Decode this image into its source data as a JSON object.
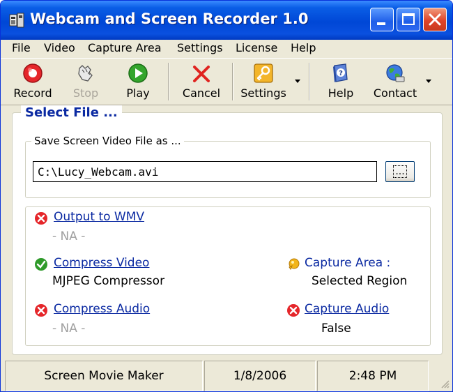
{
  "window": {
    "title": "Webcam and Screen Recorder 1.0",
    "icon": "app-recorder-icon"
  },
  "menu": [
    "File",
    "Video",
    "Capture Area",
    "Settings",
    "License",
    "Help"
  ],
  "toolbar": {
    "record": "Record",
    "stop": "Stop",
    "play": "Play",
    "cancel": "Cancel",
    "settings": "Settings",
    "help": "Help",
    "contact": "Contact"
  },
  "main": {
    "legend": "Select File ...",
    "save_legend": "Save Screen Video File as ...",
    "file_path": "C:\\Lucy_Webcam.avi",
    "browse_label": "..."
  },
  "options": {
    "wmv": {
      "label": "Output to WMV",
      "value": "- NA -",
      "status": "off"
    },
    "compress_video": {
      "label": "Compress Video",
      "value": "MJPEG Compressor",
      "status": "on"
    },
    "compress_audio": {
      "label": "Compress Audio",
      "value": "- NA -",
      "status": "off"
    },
    "capture_area": {
      "label": "Capture Area :",
      "value": "Selected Region",
      "status": "hint"
    },
    "capture_audio": {
      "label": "Capture Audio",
      "value": "False",
      "status": "off"
    }
  },
  "status": {
    "app_name": "Screen Movie Maker",
    "date": "1/8/2006",
    "time": "2:48 PM"
  },
  "colors": {
    "title_blue": "#0047d6",
    "link_blue": "#0b2aa2",
    "error_red": "#e5262a",
    "ok_green": "#2f9a2a",
    "hint_yellow": "#f2b51b"
  }
}
